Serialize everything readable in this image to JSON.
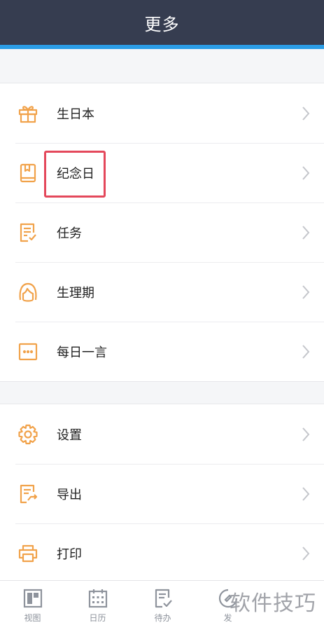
{
  "header": {
    "title": "更多"
  },
  "menu_group_1": [
    {
      "label": "生日本",
      "icon": "gift-icon"
    },
    {
      "label": "纪念日",
      "icon": "book-icon"
    },
    {
      "label": "任务",
      "icon": "task-list-icon"
    },
    {
      "label": "生理期",
      "icon": "girl-face-icon"
    },
    {
      "label": "每日一言",
      "icon": "quote-dots-icon"
    }
  ],
  "menu_group_2": [
    {
      "label": "设置",
      "icon": "gear-icon"
    },
    {
      "label": "导出",
      "icon": "export-icon"
    },
    {
      "label": "打印",
      "icon": "printer-icon"
    }
  ],
  "tabbar": [
    {
      "label": "视图",
      "icon": "layout-icon"
    },
    {
      "label": "日历",
      "icon": "calendar-icon"
    },
    {
      "label": "待办",
      "icon": "todo-icon"
    },
    {
      "label": "发",
      "icon": "publish-icon"
    }
  ],
  "watermark": "软件技巧",
  "colors": {
    "header_bg": "#363d50",
    "header_accent": "#2b9de6",
    "icon_orange": "#f1a24a",
    "highlight_red": "#e4485b",
    "tab_gray": "#8e939c"
  }
}
